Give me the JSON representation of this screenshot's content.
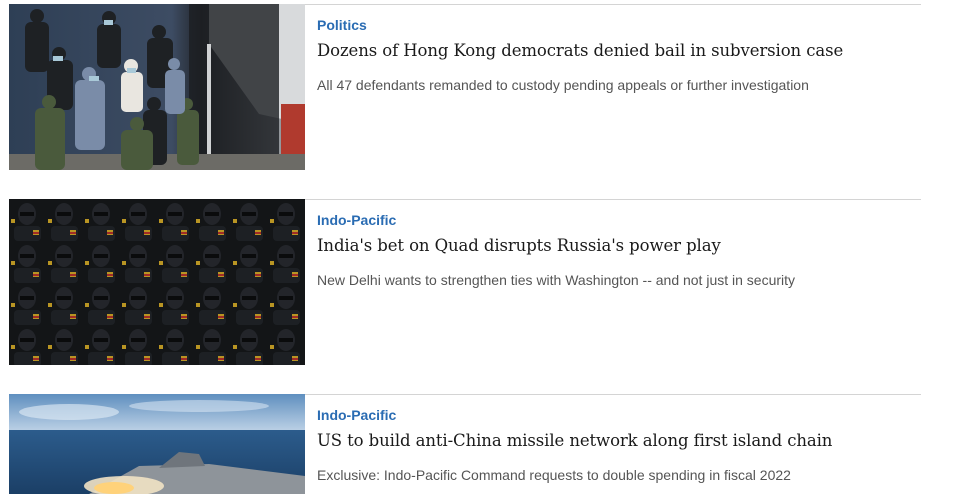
{
  "articles": [
    {
      "category": "Politics",
      "headline": "Dozens of Hong Kong democrats denied bail in subversion case",
      "summary": "All 47 defendants remanded to custody pending appeals or further investigation",
      "image_icon": "photo-icon"
    },
    {
      "category": "Indo-Pacific",
      "headline": "India's bet on Quad disrupts Russia's power play",
      "summary": "New Delhi wants to strengthen ties with Washington -- and not just in security",
      "image_icon": "photo-icon"
    },
    {
      "category": "Indo-Pacific",
      "headline": "US to build anti-China missile network along first island chain",
      "summary": "Exclusive: Indo-Pacific Command requests to double spending in fiscal 2022",
      "image_icon": "photo-icon"
    }
  ],
  "colors": {
    "category": "#2a6cb3",
    "headline": "#1a1a1a",
    "summary": "#555555",
    "divider": "#d4d4d4"
  }
}
